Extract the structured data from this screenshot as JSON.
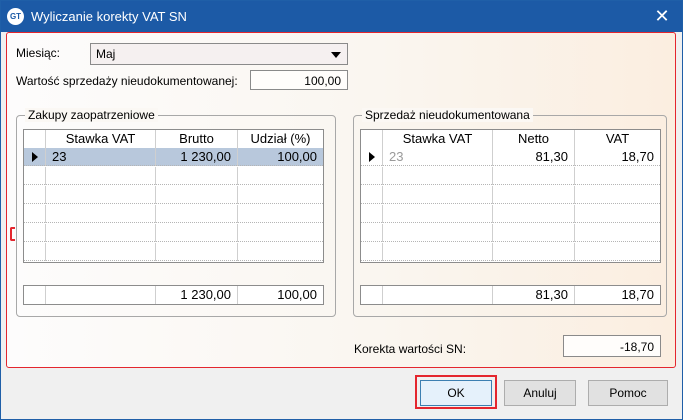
{
  "window": {
    "title": "Wyliczanie korekty VAT SN",
    "app_icon_text": "GT"
  },
  "form": {
    "month_label": "Miesiąc:",
    "month_value": "Maj",
    "undoc_sales_label": "Wartość sprzedaży nieudokumentowanej:",
    "undoc_sales_value": "100,00",
    "correction_label": "Korekta wartości SN:",
    "correction_value": "-18,70"
  },
  "purchases": {
    "title": "Zakupy zaopatrzeniowe",
    "columns": [
      "Stawka VAT",
      "Brutto",
      "Udział (%)"
    ],
    "rows": [
      [
        "23",
        "1 230,00",
        "100,00"
      ]
    ],
    "totals": [
      "",
      "1 230,00",
      "100,00"
    ]
  },
  "sales": {
    "title": "Sprzedaż nieudokumentowana",
    "columns": [
      "Stawka VAT",
      "Netto",
      "VAT"
    ],
    "rows": [
      [
        "23",
        "81,30",
        "18,70"
      ]
    ],
    "totals": [
      "",
      "81,30",
      "18,70"
    ]
  },
  "buttons": {
    "ok": "OK",
    "cancel": "Anuluj",
    "help": "Pomoc"
  },
  "colors": {
    "titlebar": "#1c5aa6",
    "highlight": "#e4262e",
    "selected_row": "#b8c8dc"
  }
}
